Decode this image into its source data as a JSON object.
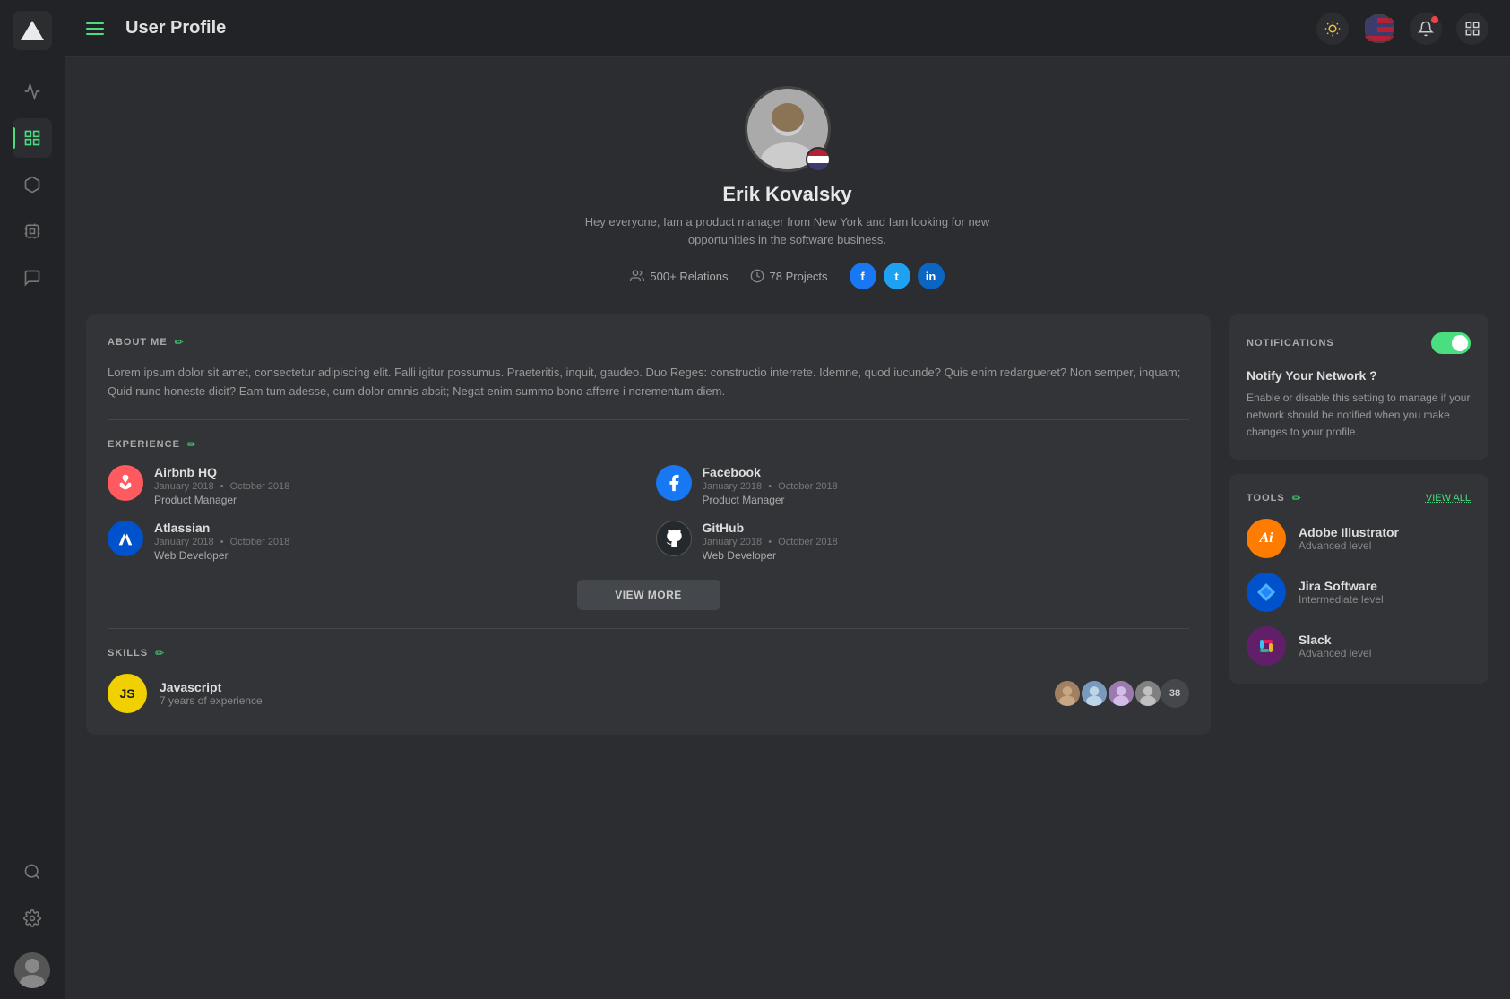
{
  "app": {
    "logo": "▲",
    "title": "User Profile"
  },
  "topbar": {
    "title": "User Profile",
    "actions": {
      "sun_label": "☀",
      "bell_label": "🔔",
      "grid_label": "⊞"
    }
  },
  "sidebar": {
    "items": [
      {
        "name": "activity",
        "icon": "⚡",
        "active": false
      },
      {
        "name": "dashboard",
        "icon": "⊞",
        "active": true
      },
      {
        "name": "cube",
        "icon": "◻",
        "active": false
      },
      {
        "name": "chip",
        "icon": "⬡",
        "active": false
      },
      {
        "name": "chat",
        "icon": "💬",
        "active": false
      },
      {
        "name": "search",
        "icon": "🔍",
        "active": false
      },
      {
        "name": "settings",
        "icon": "⚙",
        "active": false
      }
    ]
  },
  "profile": {
    "name": "Erik Kovalsky",
    "bio": "Hey everyone,  Iam a product manager from New York and Iam looking for new opportunities in the software business.",
    "relations": "500+ Relations",
    "projects": "78 Projects",
    "social": {
      "facebook": "f",
      "twitter": "t",
      "linkedin": "in"
    }
  },
  "about": {
    "title": "ABOUT ME",
    "text": "Lorem ipsum dolor sit amet, consectetur adipiscing elit. Falli igitur possumus. Praeteritis, inquit, gaudeo. Duo Reges: constructio interrete. Idemne, quod iucunde? Quis enim redargueret? Non semper, inquam; Quid nunc honeste dicit? Eam tum adesse, cum dolor omnis absit; Negat enim summo bono afferre i ncrementum diem."
  },
  "experience": {
    "title": "EXPERIENCE",
    "items": [
      {
        "company": "Airbnb HQ",
        "start": "January 2018",
        "end": "October 2018",
        "role": "Product Manager",
        "logo_type": "airbnb"
      },
      {
        "company": "Facebook",
        "start": "January 2018",
        "end": "October 2018",
        "role": "Product Manager",
        "logo_type": "facebook"
      },
      {
        "company": "Atlassian",
        "start": "January 2018",
        "end": "October 2018",
        "role": "Web Developer",
        "logo_type": "atlassian"
      },
      {
        "company": "GitHub",
        "start": "January 2018",
        "end": "October 2018",
        "role": "Web Developer",
        "logo_type": "github"
      }
    ],
    "view_more": "VIEW MORE"
  },
  "skills": {
    "title": "SKILLS",
    "items": [
      {
        "name": "Javascript",
        "exp": "7 years of experience",
        "badge": "JS",
        "count": "38"
      }
    ]
  },
  "notifications": {
    "title": "NOTIFICATIONS",
    "enabled": true,
    "subtitle": "Notify Your Network ?",
    "description": "Enable or disable this setting to manage if your network should be notified when you make changes to your profile."
  },
  "tools": {
    "title": "TOOLS",
    "view_all": "VIEW ALL",
    "items": [
      {
        "name": "Adobe Illustrator",
        "level": "Advanced level",
        "logo_type": "ai",
        "logo_text": "Ai"
      },
      {
        "name": "Jira Software",
        "level": "Intermediate level",
        "logo_type": "jira",
        "logo_text": "◆"
      },
      {
        "name": "Slack",
        "level": "Advanced level",
        "logo_type": "slack",
        "logo_text": "#"
      }
    ]
  }
}
